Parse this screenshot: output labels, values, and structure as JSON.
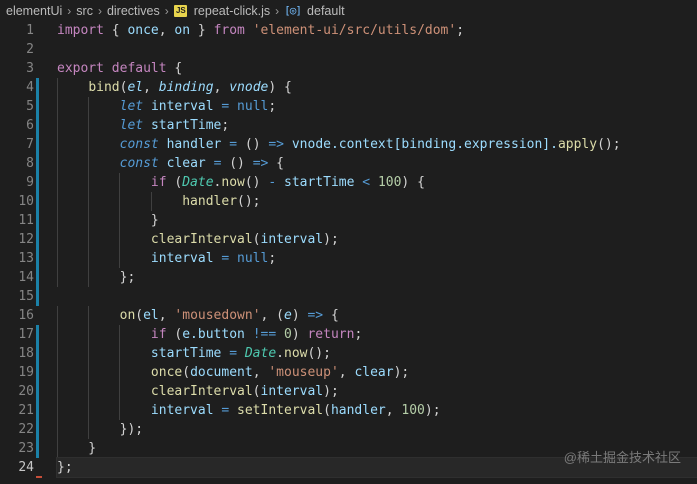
{
  "breadcrumb": {
    "items": [
      "elementUi",
      "src",
      "directives",
      "repeat-click.js",
      "default"
    ],
    "separator": "›",
    "file_icon_label": "JS"
  },
  "gutter": {
    "line_numbers": [
      "1",
      "2",
      "3",
      "4",
      "5",
      "6",
      "7",
      "8",
      "9",
      "10",
      "11",
      "12",
      "13",
      "14",
      "15",
      "16",
      "17",
      "18",
      "19",
      "20",
      "21",
      "22",
      "23",
      "24"
    ],
    "active_line": "24"
  },
  "code": {
    "lines": [
      [
        [
          "kw-ctl",
          "import"
        ],
        [
          "p",
          " { "
        ],
        [
          "id",
          "once"
        ],
        [
          "p",
          ", "
        ],
        [
          "id",
          "on"
        ],
        [
          "p",
          " } "
        ],
        [
          "kw-ctl",
          "from"
        ],
        [
          "p",
          " "
        ],
        [
          "str",
          "'element-ui/src/utils/dom'"
        ],
        [
          "p",
          ";"
        ]
      ],
      [],
      [
        [
          "kw-ctl",
          "export"
        ],
        [
          "p",
          " "
        ],
        [
          "kw-ctl",
          "default"
        ],
        [
          "p",
          " {"
        ]
      ],
      [
        [
          "p",
          "    "
        ],
        [
          "fn",
          "bind"
        ],
        [
          "p",
          "("
        ],
        [
          "param",
          "el"
        ],
        [
          "p",
          ", "
        ],
        [
          "param",
          "binding"
        ],
        [
          "p",
          ", "
        ],
        [
          "param",
          "vnode"
        ],
        [
          "p",
          ") {"
        ]
      ],
      [
        [
          "p",
          "        "
        ],
        [
          "kw-it",
          "let"
        ],
        [
          "p",
          " "
        ],
        [
          "id",
          "interval"
        ],
        [
          "p",
          " "
        ],
        [
          "kw",
          "="
        ],
        [
          "p",
          " "
        ],
        [
          "kw",
          "null"
        ],
        [
          "p",
          ";"
        ]
      ],
      [
        [
          "p",
          "        "
        ],
        [
          "kw-it",
          "let"
        ],
        [
          "p",
          " "
        ],
        [
          "id",
          "startTime"
        ],
        [
          "p",
          ";"
        ]
      ],
      [
        [
          "p",
          "        "
        ],
        [
          "kw-it",
          "const"
        ],
        [
          "p",
          " "
        ],
        [
          "var",
          "handler"
        ],
        [
          "p",
          " "
        ],
        [
          "kw",
          "="
        ],
        [
          "p",
          " () "
        ],
        [
          "kw",
          "=>"
        ],
        [
          "p",
          " "
        ],
        [
          "id",
          "vnode.context[binding.expression]."
        ],
        [
          "fn",
          "apply"
        ],
        [
          "p",
          "();"
        ]
      ],
      [
        [
          "p",
          "        "
        ],
        [
          "kw-it",
          "const"
        ],
        [
          "p",
          " "
        ],
        [
          "var",
          "clear"
        ],
        [
          "p",
          " "
        ],
        [
          "kw",
          "="
        ],
        [
          "p",
          " () "
        ],
        [
          "kw",
          "=>"
        ],
        [
          "p",
          " {"
        ]
      ],
      [
        [
          "p",
          "            "
        ],
        [
          "kw-ctl",
          "if"
        ],
        [
          "p",
          " ("
        ],
        [
          "type-it",
          "Date"
        ],
        [
          "p",
          "."
        ],
        [
          "fn",
          "now"
        ],
        [
          "p",
          "() "
        ],
        [
          "kw",
          "-"
        ],
        [
          "p",
          " "
        ],
        [
          "id",
          "startTime"
        ],
        [
          "p",
          " "
        ],
        [
          "kw",
          "<"
        ],
        [
          "p",
          " "
        ],
        [
          "num",
          "100"
        ],
        [
          "p",
          ") {"
        ]
      ],
      [
        [
          "p",
          "                "
        ],
        [
          "fn",
          "handler"
        ],
        [
          "p",
          "();"
        ]
      ],
      [
        [
          "p",
          "            }"
        ]
      ],
      [
        [
          "p",
          "            "
        ],
        [
          "fn",
          "clearInterval"
        ],
        [
          "p",
          "("
        ],
        [
          "id",
          "interval"
        ],
        [
          "p",
          ");"
        ]
      ],
      [
        [
          "p",
          "            "
        ],
        [
          "id",
          "interval"
        ],
        [
          "p",
          " "
        ],
        [
          "kw",
          "="
        ],
        [
          "p",
          " "
        ],
        [
          "kw",
          "null"
        ],
        [
          "p",
          ";"
        ]
      ],
      [
        [
          "p",
          "        };"
        ]
      ],
      [],
      [
        [
          "p",
          "        "
        ],
        [
          "fn",
          "on"
        ],
        [
          "p",
          "("
        ],
        [
          "id",
          "el"
        ],
        [
          "p",
          ", "
        ],
        [
          "str",
          "'mousedown'"
        ],
        [
          "p",
          ", ("
        ],
        [
          "param",
          "e"
        ],
        [
          "p",
          ") "
        ],
        [
          "kw",
          "=>"
        ],
        [
          "p",
          " {"
        ]
      ],
      [
        [
          "p",
          "            "
        ],
        [
          "kw-ctl",
          "if"
        ],
        [
          "p",
          " ("
        ],
        [
          "id",
          "e.button"
        ],
        [
          "p",
          " "
        ],
        [
          "kw",
          "!=="
        ],
        [
          "p",
          " "
        ],
        [
          "num",
          "0"
        ],
        [
          "p",
          ") "
        ],
        [
          "kw-ctl",
          "return"
        ],
        [
          "p",
          ";"
        ]
      ],
      [
        [
          "p",
          "            "
        ],
        [
          "id",
          "startTime"
        ],
        [
          "p",
          " "
        ],
        [
          "kw",
          "="
        ],
        [
          "p",
          " "
        ],
        [
          "type-it",
          "Date"
        ],
        [
          "p",
          "."
        ],
        [
          "fn",
          "now"
        ],
        [
          "p",
          "();"
        ]
      ],
      [
        [
          "p",
          "            "
        ],
        [
          "fn",
          "once"
        ],
        [
          "p",
          "("
        ],
        [
          "id",
          "document"
        ],
        [
          "p",
          ", "
        ],
        [
          "str",
          "'mouseup'"
        ],
        [
          "p",
          ", "
        ],
        [
          "id",
          "clear"
        ],
        [
          "p",
          ");"
        ]
      ],
      [
        [
          "p",
          "            "
        ],
        [
          "fn",
          "clearInterval"
        ],
        [
          "p",
          "("
        ],
        [
          "id",
          "interval"
        ],
        [
          "p",
          ");"
        ]
      ],
      [
        [
          "p",
          "            "
        ],
        [
          "id",
          "interval"
        ],
        [
          "p",
          " "
        ],
        [
          "kw",
          "="
        ],
        [
          "p",
          " "
        ],
        [
          "fn",
          "setInterval"
        ],
        [
          "p",
          "("
        ],
        [
          "id",
          "handler"
        ],
        [
          "p",
          ", "
        ],
        [
          "num",
          "100"
        ],
        [
          "p",
          ");"
        ]
      ],
      [
        [
          "p",
          "        });"
        ]
      ],
      [
        [
          "p",
          "    }"
        ]
      ],
      [
        [
          "p",
          "};"
        ]
      ]
    ]
  },
  "watermark": "@稀土掘金技术社区",
  "colors": {
    "background": "#1e1e1e",
    "keyword": "#569cd6",
    "control": "#c586c0",
    "string": "#ce9178",
    "function": "#dcdcaa",
    "variable": "#9cdcfe",
    "number": "#b5cea8",
    "type": "#4ec9b0",
    "change_bar": "#1b81a8"
  }
}
